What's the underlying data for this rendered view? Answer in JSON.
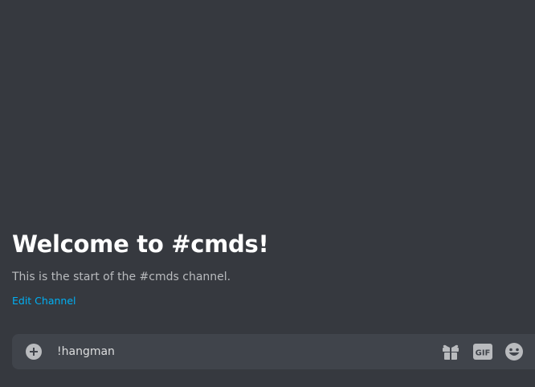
{
  "channel": {
    "welcome_title": "Welcome to #cmds!",
    "welcome_subtitle": "This is the start of the #cmds channel.",
    "edit_channel_label": "Edit Channel"
  },
  "composer": {
    "input_value": "!hangman",
    "gif_label": "GIF",
    "icons": [
      "add-circle-icon",
      "gift-icon",
      "gif-icon",
      "emoji-smile-icon"
    ]
  },
  "colors": {
    "background": "#36393f",
    "composer_background": "#40444b",
    "link": "#00b0f4",
    "icon": "#b9bbbe"
  }
}
